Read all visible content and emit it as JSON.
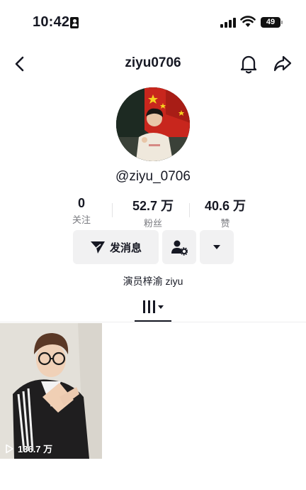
{
  "status_bar": {
    "time": "10:42",
    "battery": "49"
  },
  "nav": {
    "title": "ziyu0706",
    "back_icon": "chevron-left-icon",
    "bell_icon": "bell-icon",
    "share_icon": "share-arrow-icon"
  },
  "profile": {
    "handle": "@ziyu_0706",
    "bio": "演员梓渝 ziyu"
  },
  "stats": [
    {
      "value": "0",
      "label": "关注"
    },
    {
      "value": "52.7 万",
      "label": "粉丝"
    },
    {
      "value": "40.6 万",
      "label": "赞"
    }
  ],
  "actions": {
    "message_label": "发消息",
    "message_icon": "send-icon",
    "follow_user_icon": "user-settings-icon",
    "more_icon": "caret-down-icon"
  },
  "tabs": {
    "grid_icon": "grid-bars-icon"
  },
  "videos": [
    {
      "views": "136.7 万"
    }
  ],
  "colors": {
    "text": "#161823",
    "secondary": "#7a7b80",
    "button_bg": "#f1f1f2"
  }
}
